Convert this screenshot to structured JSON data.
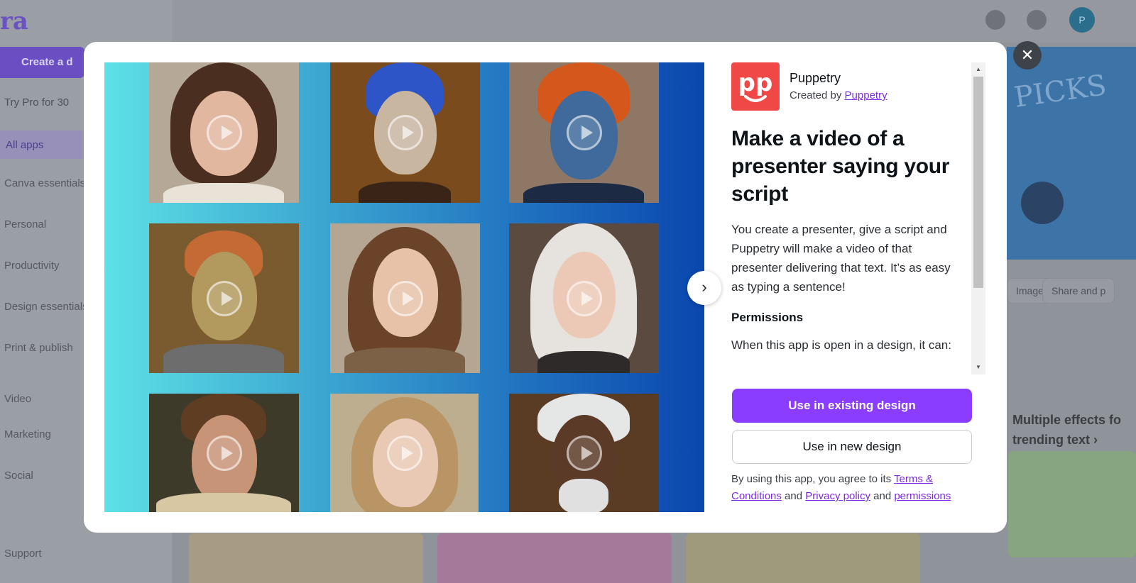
{
  "background": {
    "logo_fragment": "ra",
    "create_label": "Create a d",
    "trypro_label": "Try Pro for 30",
    "active_item": "All apps",
    "sidebar_items": [
      "Canva essentials",
      "Personal",
      "Productivity",
      "Design essentials",
      "Print & publish",
      "Video",
      "Marketing",
      "Social",
      "Support"
    ],
    "avatar_letter": "P",
    "banner_text": "PICKS",
    "pills": [
      "Images",
      "Share and p"
    ],
    "promo_line1": "Multiple effects fo",
    "promo_line2": "trending text ›"
  },
  "modal": {
    "close_icon": "close-icon",
    "next_icon": "chevron-right-icon",
    "gallery": {
      "tiles": [
        {
          "alt": "woman with brown wavy hair"
        },
        {
          "alt": "robot woman with blue hair"
        },
        {
          "alt": "blue-skinned man with red hair"
        },
        {
          "alt": "golden android with copper hair"
        },
        {
          "alt": "smiling woman with long brown hair"
        },
        {
          "alt": "woman with white hair"
        },
        {
          "alt": "man with spiky hair"
        },
        {
          "alt": "woman with blonde wavy hair"
        },
        {
          "alt": "older man with white hair"
        }
      ]
    },
    "app": {
      "logo_text": "pp",
      "name": "Puppetry",
      "created_by_prefix": "Created by ",
      "created_by_link": "Puppetry",
      "headline": "Make a video of a presenter saying your script",
      "description": "You create a presenter, give a script and Puppetry will make a video of that presenter delivering that text. It’s as easy as typing a sentence!",
      "permissions_title": "Permissions",
      "permissions_text": "When this app is open in a design, it can:"
    },
    "actions": {
      "primary": "Use in existing design",
      "secondary": "Use in new design"
    },
    "terms": {
      "prefix": "By using this app, you agree to its ",
      "terms_link": "Terms & Conditions",
      "and1": " and ",
      "privacy_link": "Privacy policy",
      "and2": " and ",
      "permissions_link": "permissions"
    },
    "colors": {
      "primary": "#8b3dff",
      "link": "#7d2ae8",
      "logo_bg": "#f04747"
    }
  }
}
